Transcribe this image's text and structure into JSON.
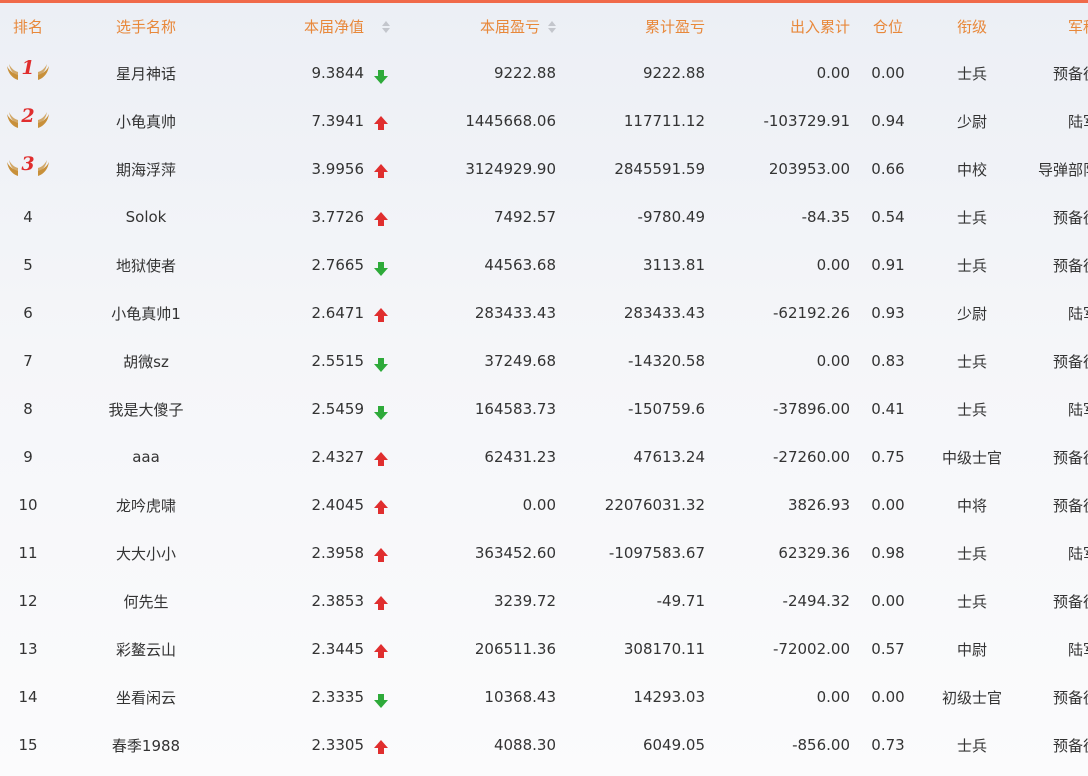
{
  "colors": {
    "header_text": "#e8883a",
    "up": "#e02e2e",
    "down": "#2eaa3a",
    "medal_number": "#e02e2e",
    "wing": "#c8903a"
  },
  "header": {
    "rank": "排名",
    "player": "选手名称",
    "net": "本届净值",
    "pnl": "本届盈亏",
    "cum_pnl": "累计盈亏",
    "cum_flow": "出入累计",
    "position": "仓位",
    "grade": "衔级",
    "army": "军种"
  },
  "rows": [
    {
      "rank": "1",
      "medal": true,
      "name": "星月神话",
      "net": "9.3844",
      "trend": "down",
      "pnl": "9222.88",
      "cum": "9222.88",
      "flow": "0.00",
      "pos": "0.00",
      "grade": "士兵",
      "army": "预备役"
    },
    {
      "rank": "2",
      "medal": true,
      "name": "小龟真帅",
      "net": "7.3941",
      "trend": "up",
      "pnl": "1445668.06",
      "cum": "117711.12",
      "flow": "-103729.91",
      "pos": "0.94",
      "grade": "少尉",
      "army": "陆军"
    },
    {
      "rank": "3",
      "medal": true,
      "name": "期海浮萍",
      "net": "3.9956",
      "trend": "up",
      "pnl": "3124929.90",
      "cum": "2845591.59",
      "flow": "203953.00",
      "pos": "0.66",
      "grade": "中校",
      "army": "导弹部队"
    },
    {
      "rank": "4",
      "medal": false,
      "name": "Solok",
      "net": "3.7726",
      "trend": "up",
      "pnl": "7492.57",
      "cum": "-9780.49",
      "flow": "-84.35",
      "pos": "0.54",
      "grade": "士兵",
      "army": "预备役"
    },
    {
      "rank": "5",
      "medal": false,
      "name": "地狱使者",
      "net": "2.7665",
      "trend": "down",
      "pnl": "44563.68",
      "cum": "3113.81",
      "flow": "0.00",
      "pos": "0.91",
      "grade": "士兵",
      "army": "预备役"
    },
    {
      "rank": "6",
      "medal": false,
      "name": "小龟真帅1",
      "net": "2.6471",
      "trend": "up",
      "pnl": "283433.43",
      "cum": "283433.43",
      "flow": "-62192.26",
      "pos": "0.93",
      "grade": "少尉",
      "army": "陆军"
    },
    {
      "rank": "7",
      "medal": false,
      "name": "胡微sz",
      "net": "2.5515",
      "trend": "down",
      "pnl": "37249.68",
      "cum": "-14320.58",
      "flow": "0.00",
      "pos": "0.83",
      "grade": "士兵",
      "army": "预备役"
    },
    {
      "rank": "8",
      "medal": false,
      "name": "我是大傻子",
      "net": "2.5459",
      "trend": "down",
      "pnl": "164583.73",
      "cum": "-150759.6",
      "flow": "-37896.00",
      "pos": "0.41",
      "grade": "士兵",
      "army": "陆军"
    },
    {
      "rank": "9",
      "medal": false,
      "name": "aaa",
      "net": "2.4327",
      "trend": "up",
      "pnl": "62431.23",
      "cum": "47613.24",
      "flow": "-27260.00",
      "pos": "0.75",
      "grade": "中级士官",
      "army": "预备役"
    },
    {
      "rank": "10",
      "medal": false,
      "name": "龙吟虎啸",
      "net": "2.4045",
      "trend": "up",
      "pnl": "0.00",
      "cum": "22076031.32",
      "flow": "3826.93",
      "pos": "0.00",
      "grade": "中将",
      "army": "预备役"
    },
    {
      "rank": "11",
      "medal": false,
      "name": "大大小小",
      "net": "2.3958",
      "trend": "up",
      "pnl": "363452.60",
      "cum": "-1097583.67",
      "flow": "62329.36",
      "pos": "0.98",
      "grade": "士兵",
      "army": "陆军"
    },
    {
      "rank": "12",
      "medal": false,
      "name": "何先生",
      "net": "2.3853",
      "trend": "up",
      "pnl": "3239.72",
      "cum": "-49.71",
      "flow": "-2494.32",
      "pos": "0.00",
      "grade": "士兵",
      "army": "预备役"
    },
    {
      "rank": "13",
      "medal": false,
      "name": "彩鳌云山",
      "net": "2.3445",
      "trend": "up",
      "pnl": "206511.36",
      "cum": "308170.11",
      "flow": "-72002.00",
      "pos": "0.57",
      "grade": "中尉",
      "army": "陆军"
    },
    {
      "rank": "14",
      "medal": false,
      "name": "坐看闲云",
      "net": "2.3335",
      "trend": "down",
      "pnl": "10368.43",
      "cum": "14293.03",
      "flow": "0.00",
      "pos": "0.00",
      "grade": "初级士官",
      "army": "预备役"
    },
    {
      "rank": "15",
      "medal": false,
      "name": "春季1988",
      "net": "2.3305",
      "trend": "up",
      "pnl": "4088.30",
      "cum": "6049.05",
      "flow": "-856.00",
      "pos": "0.73",
      "grade": "士兵",
      "army": "预备役"
    }
  ]
}
